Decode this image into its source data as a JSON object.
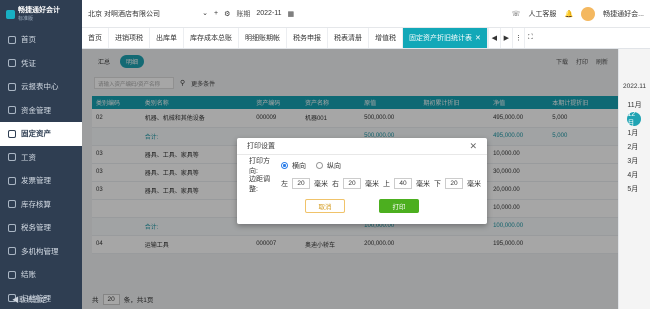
{
  "brand": {
    "name": "畅捷通好会计",
    "sub": "标准版"
  },
  "sidebar": {
    "items": [
      {
        "label": "首页",
        "icon": "home-icon"
      },
      {
        "label": "凭证",
        "icon": "voucher-icon"
      },
      {
        "label": "云报表中心",
        "icon": "report-icon"
      },
      {
        "label": "资金管理",
        "icon": "money-icon"
      },
      {
        "label": "固定资产",
        "icon": "asset-icon",
        "active": true
      },
      {
        "label": "工资",
        "icon": "salary-icon"
      },
      {
        "label": "发票管理",
        "icon": "invoice-icon"
      },
      {
        "label": "库存核算",
        "icon": "stock-icon"
      },
      {
        "label": "税务管理",
        "icon": "tax-icon"
      },
      {
        "label": "多机构管理",
        "icon": "org-icon"
      },
      {
        "label": "结账",
        "icon": "close-account-icon"
      },
      {
        "label": "归档管理",
        "icon": "archive-icon"
      }
    ],
    "collapse_label": "◀取消固定"
  },
  "topbar": {
    "company": "北京 对啊酒店有限公司",
    "period_label": "账期",
    "period_value": "2022-11",
    "support": "人工客服",
    "user": "畅捷通好会..."
  },
  "tabs": [
    "首页",
    "进销项税",
    "出库单",
    "库存成本总账",
    "明细账期帐",
    "税务申报",
    "税表清册",
    "增值税",
    "固定资产折旧统计表"
  ],
  "toolbar": {
    "summary": "汇总",
    "detail": "明细",
    "download": "下载",
    "print": "打印",
    "refresh": "刷新"
  },
  "filter": {
    "search_placeholder": "请输入资产编码/资产名称",
    "more": "更多条件"
  },
  "table": {
    "headers": [
      "类别编码",
      "类别名称",
      "资产编码",
      "资产名称",
      "原值",
      "期初累计折旧",
      "净值",
      "本期计提折旧"
    ],
    "rows": [
      [
        "02",
        "机器、机械和其他设备",
        "000009",
        "机器001",
        "500,000.00",
        "",
        "495,000.00",
        "5,000"
      ],
      [
        "",
        "合计:",
        "",
        "",
        "500,000.00",
        "",
        "495,000.00",
        "5,000"
      ],
      [
        "03",
        "器具、工具、家具等",
        "",
        "",
        "",
        "",
        "10,000.00",
        ""
      ],
      [
        "03",
        "器具、工具、家具等",
        "",
        "",
        "",
        "",
        "30,000.00",
        ""
      ],
      [
        "03",
        "器具、工具、家具等",
        "",
        "",
        "",
        "",
        "20,000.00",
        ""
      ],
      [
        "",
        "",
        "000005",
        "请输项目",
        "",
        "",
        "10,000.00",
        ""
      ],
      [
        "",
        "合计:",
        "",
        "",
        "100,000.00",
        "",
        "100,000.00",
        ""
      ],
      [
        "04",
        "运输工具",
        "000007",
        "奥迪小轿车",
        "200,000.00",
        "",
        "195,000.00",
        ""
      ]
    ]
  },
  "pager": {
    "total_label": "共",
    "page_size": "20",
    "page_suffix": "条，共1页"
  },
  "calendar": {
    "year": "2022.11",
    "months": [
      "11月",
      "12月",
      "1月",
      "2月",
      "3月",
      "4月",
      "5月"
    ],
    "active_month": "12月"
  },
  "dialog": {
    "title": "打印设置",
    "orientation_label": "打印方向:",
    "portrait": "横向",
    "landscape": "纵向",
    "margin_label": "边距调整:",
    "left_label": "左",
    "left_value": "20",
    "right_label": "右",
    "right_value": "20",
    "top_label": "上",
    "top_value": "40",
    "bottom_label": "下",
    "bottom_value": "20",
    "unit": "毫米",
    "cancel": "取消",
    "print": "打印"
  }
}
